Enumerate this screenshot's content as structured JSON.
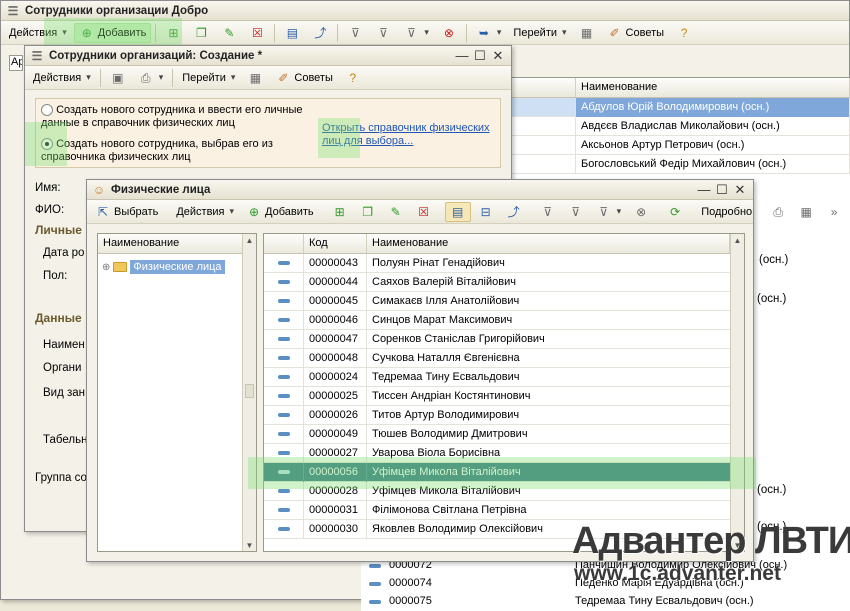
{
  "main": {
    "title": "Сотрудники организации Добро",
    "toolbar": {
      "actions": "Действия",
      "add": "Добавить",
      "goto": "Перейти",
      "tips": "Советы"
    },
    "search_fragment": "Ар",
    "list_header": "Наименование",
    "list": [
      "Абдулов Юрій Володимирович (осн.)",
      "Авдєєв Владислав Миколайович (осн.)",
      "Аксьонов Артур Петрович (осн.)",
      "Богословський Федір Михайлович (осн.)"
    ],
    "peek_right": [
      "(осн.)",
      "(осн.)",
      "(осн.)",
      "(осн.)"
    ],
    "bottom_rows": [
      {
        "code": "0000072",
        "name": "Панчишин Володимир Олексійович (осн.)"
      },
      {
        "code": "0000074",
        "name": "Педенко Марія Едуардівна (осн.)"
      },
      {
        "code": "0000075",
        "name": "Тедремаа Тину Есвальдович (осн.)"
      }
    ]
  },
  "create": {
    "title": "Сотрудники организаций: Создание *",
    "toolbar": {
      "actions": "Действия",
      "goto": "Перейти",
      "tips": "Советы"
    },
    "option1": "Создать нового сотрудника и ввести его личные данные в справочник физических лиц",
    "option2": "Создать нового сотрудника, выбрав его из справочника физических лиц",
    "link": "Открыть справочник физических лиц для выбора...",
    "fields": {
      "name": "Имя:",
      "fio": "ФИО:",
      "personal": "Личные",
      "birth": "Дата ро",
      "sex": "Пол:",
      "data": "Данные",
      "naim": "Наимен",
      "org": "Органи",
      "vid": "Вид зан",
      "tab": "Табельн",
      "group": "Группа со"
    }
  },
  "phys": {
    "title": "Физические лица",
    "toolbar": {
      "select": "Выбрать",
      "actions": "Действия",
      "add": "Добавить",
      "detail": "Подробно"
    },
    "tree_header": "Наименование",
    "tree_item": "Физические лица",
    "col_code": "Код",
    "col_name": "Наименование",
    "rows": [
      {
        "code": "00000043",
        "name": "Полуян Рінат Генадійович"
      },
      {
        "code": "00000044",
        "name": "Саяхов Валерій Віталійович"
      },
      {
        "code": "00000045",
        "name": "Симакаєв Ілля Анатолійович"
      },
      {
        "code": "00000046",
        "name": "Синцов Марат Максимович"
      },
      {
        "code": "00000047",
        "name": "Соренков Станіслав Григорійович"
      },
      {
        "code": "00000048",
        "name": "Сучкова Наталля Євгенієвна"
      },
      {
        "code": "00000024",
        "name": "Тедремаа Тину Есвальдович"
      },
      {
        "code": "00000025",
        "name": "Тиссен Андріан Костянтинович"
      },
      {
        "code": "00000026",
        "name": "Титов Артур Володимирович"
      },
      {
        "code": "00000049",
        "name": "Тюшев Володимир Дмитрович"
      },
      {
        "code": "00000027",
        "name": "Уварова Віола Борисівна"
      },
      {
        "code": "00000056",
        "name": "Уфімцев Микола Віталійович"
      },
      {
        "code": "00000028",
        "name": "Уфімцев Микола Віталійович"
      },
      {
        "code": "00000031",
        "name": "Філімонова Світлана Петрівна"
      },
      {
        "code": "00000030",
        "name": "Яковлев Володимир Олексійович"
      }
    ],
    "selected_index": 11
  },
  "watermark": {
    "line1": "Адвантер ЛВТИ",
    "line2": "www.1c.advanter.net"
  }
}
